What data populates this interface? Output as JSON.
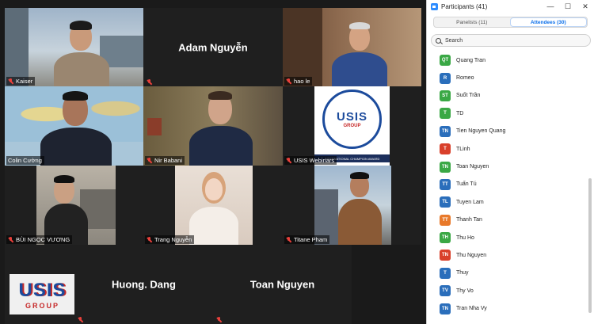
{
  "video_grid": {
    "tiles": [
      {
        "name": "Kaiser",
        "center_name": ""
      },
      {
        "name": "",
        "center_name": "Adam Nguyễn"
      },
      {
        "name": "hao le",
        "center_name": ""
      },
      {
        "name": "Colin Cường",
        "center_name": ""
      },
      {
        "name": "Nir Babani",
        "center_name": ""
      },
      {
        "name": "USIS Webinars",
        "center_name": ""
      },
      {
        "name": "BÙI NGỌC VƯƠNG",
        "center_name": ""
      },
      {
        "name": "Trang Nguyễn",
        "center_name": ""
      },
      {
        "name": "Titane Pham",
        "center_name": ""
      },
      {
        "name": "",
        "center_name": ""
      },
      {
        "name": "",
        "center_name": "Huong. Dang"
      },
      {
        "name": "",
        "center_name": "Toan Nguyen"
      }
    ],
    "logo": {
      "main": "USIS",
      "sub": "GROUP"
    },
    "webinar_logo": {
      "main": "USIS",
      "sub": "GROUP",
      "ring_text": "GIẢI THƯỞNG CÔNG TY TƯ VẤN ĐỊNH CƯ TỐT NHẤT TOÀN CẦU",
      "banner": "INTERNATIONAL CHAMPION AWARD"
    }
  },
  "panel": {
    "title": "Participants (41)",
    "controls": {
      "minimize": "—",
      "maximize": "☐",
      "close": "✕"
    },
    "tabs": [
      {
        "label": "Panelists (11)",
        "selected": false
      },
      {
        "label": "Attendees (30)",
        "selected": true
      }
    ],
    "search_placeholder": "Search",
    "participants": [
      {
        "initials": "QT",
        "name": "Quang Tran",
        "color": "#3aa845"
      },
      {
        "initials": "R",
        "name": "Romeo",
        "color": "#2a6ebb"
      },
      {
        "initials": "ST",
        "name": "Suốt Trần",
        "color": "#3aa845"
      },
      {
        "initials": "T",
        "name": "TD",
        "color": "#3aa845"
      },
      {
        "initials": "TN",
        "name": "Tien Nguyen Quang",
        "color": "#2a6ebb"
      },
      {
        "initials": "T",
        "name": "TLinh",
        "color": "#d9402b"
      },
      {
        "initials": "TN",
        "name": "Toan Nguyen",
        "color": "#3aa845"
      },
      {
        "initials": "TT",
        "name": "Tuấn Tú",
        "color": "#2a6ebb"
      },
      {
        "initials": "TL",
        "name": "Tuyen Lam",
        "color": "#2a6ebb"
      },
      {
        "initials": "TT",
        "name": "Thanh Tan",
        "color": "#e8792a"
      },
      {
        "initials": "TH",
        "name": "Thu Ho",
        "color": "#3aa845"
      },
      {
        "initials": "TN",
        "name": "Thu Nguyen",
        "color": "#d9402b"
      },
      {
        "initials": "T",
        "name": "Thuy",
        "color": "#2a6ebb"
      },
      {
        "initials": "TV",
        "name": "Thy Vo",
        "color": "#2a6ebb"
      },
      {
        "initials": "TN",
        "name": "Tran Nha Vy",
        "color": "#2a6ebb"
      }
    ]
  }
}
